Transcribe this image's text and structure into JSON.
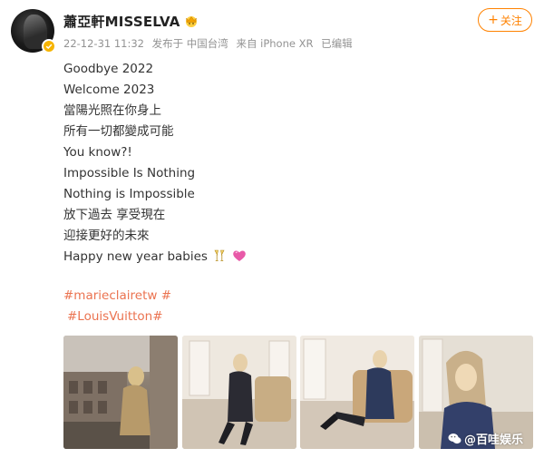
{
  "user": {
    "name": "蕭亞軒MISSELVA",
    "avatar_icon": "profile-avatar",
    "verified_icon": "verified-badge-icon",
    "crown_icon": "crown-emoji-icon"
  },
  "meta": {
    "time": "22-12-31 11:32",
    "posted_from": "发布于 中国台湾",
    "device": "来自 iPhone XR",
    "edited": "已编辑"
  },
  "follow_button": {
    "label": "关注",
    "plus": "+"
  },
  "post": {
    "lines": [
      "Goodbye 2022",
      "Welcome 2023",
      "當陽光照在你身上",
      "所有一切都變成可能",
      "You know?!",
      "Impossible Is Nothing",
      "Nothing is Impossible",
      "放下過去 享受現在",
      "迎接更好的未來",
      "Happy new year babies"
    ],
    "emoji_icons": [
      "champagne-cheers-icon",
      "pink-heart-icon"
    ],
    "hashtags": [
      "#marieclairetw #",
      "#LouisVuitton#"
    ]
  },
  "gallery": {
    "images": [
      "paris-rooftop-photo",
      "white-room-chair-photo",
      "sofa-pose-photo",
      "portrait-closeup-photo"
    ]
  },
  "watermark": {
    "text": "@百哇娱乐",
    "icon": "wechat-logo-icon"
  },
  "colors": {
    "accent": "#ff8200",
    "hashtag": "#eb7350",
    "meta": "#939393",
    "verified": "#f6b400"
  }
}
